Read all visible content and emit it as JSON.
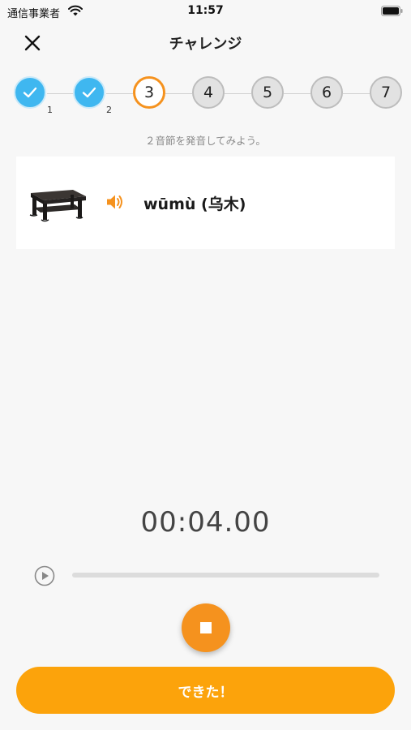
{
  "status_bar": {
    "carrier": "通信事業者",
    "time": "11:57",
    "icons": [
      "wifi-icon",
      "battery-icon"
    ]
  },
  "nav": {
    "title": "チャレンジ",
    "close_icon": "close-icon"
  },
  "stepper": {
    "steps": [
      {
        "label": "✓",
        "state": "done",
        "sub": "1"
      },
      {
        "label": "✓",
        "state": "done",
        "sub": "2"
      },
      {
        "label": "3",
        "state": "active",
        "sub": ""
      },
      {
        "label": "4",
        "state": "todo",
        "sub": ""
      },
      {
        "label": "5",
        "state": "todo",
        "sub": ""
      },
      {
        "label": "6",
        "state": "todo",
        "sub": ""
      },
      {
        "label": "7",
        "state": "todo",
        "sub": ""
      }
    ]
  },
  "instruction": "２音節を発音してみよう。",
  "word_card": {
    "image": "table-image",
    "speaker_icon": "speaker-icon",
    "word": "wūmù (乌木)"
  },
  "recorder": {
    "timer": "00:04.00",
    "progress": 0,
    "play_icon": "play-icon",
    "stop_icon": "stop-icon"
  },
  "done_button": {
    "label": "できた！"
  },
  "colors": {
    "accent_orange": "#f5921e",
    "button_orange": "#fca30b",
    "done_blue": "#3fb7f0",
    "background": "#f7f7f7"
  }
}
